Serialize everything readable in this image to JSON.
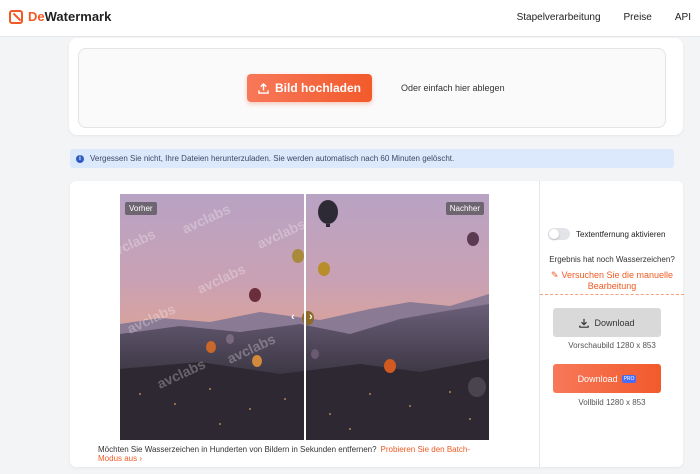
{
  "app": {
    "brand_prefix": "De",
    "brand_suffix": "Watermark"
  },
  "nav": {
    "links": [
      "Stapelverarbeitung",
      "Preise",
      "API"
    ]
  },
  "upload": {
    "button_label": "Bild hochladen",
    "drop_hint": "Oder einfach hier ablegen"
  },
  "notice": {
    "text": "Vergessen Sie nicht, Ihre Dateien herunterzuladen. Sie werden automatisch nach 60 Minuten gelöscht."
  },
  "compare": {
    "before_label": "Vorher",
    "after_label": "Nachher",
    "watermark_text": "avclabs"
  },
  "batch": {
    "text": "Möchten Sie Wasserzeichen in Hunderten von Bildern in Sekunden entfernen?",
    "link": "Probieren Sie den Batch-Modus aus"
  },
  "side": {
    "text_removal_label": "Textentfernung aktivieren",
    "text_removal_enabled": false,
    "still_watermark": "Ergebnis hat noch Wasserzeichen?",
    "manual_edit_link": "Versuchen Sie die manuelle Bearbeitung",
    "download_preview_label": "Download",
    "preview_caption": "Vorschaubild 1280 x 853",
    "download_full_label": "Download",
    "pro_badge": "PRO",
    "full_caption": "Vollbild 1280 x 853"
  },
  "colors": {
    "accent": "#f05a24",
    "info_bg": "#dce8fb"
  }
}
